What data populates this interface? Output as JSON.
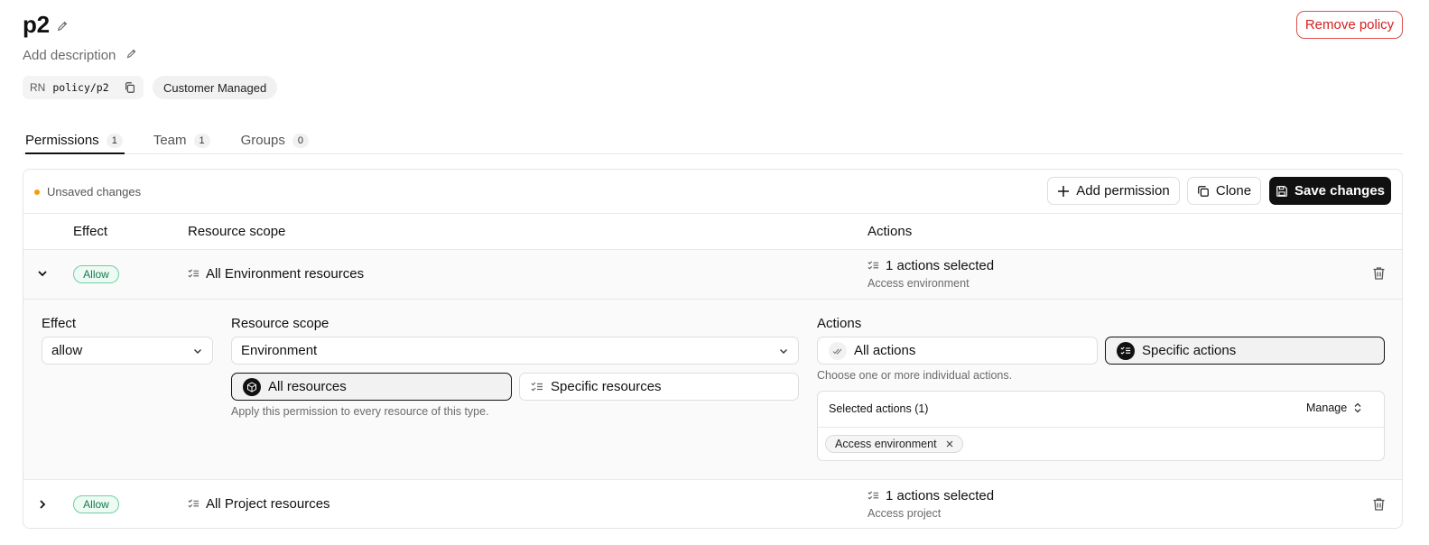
{
  "policy": {
    "title": "p2",
    "description_placeholder": "Add description",
    "rn_label": "RN",
    "rn_value": "policy/p2",
    "type_badge": "Customer Managed",
    "remove_label": "Remove policy"
  },
  "tabs": [
    {
      "label": "Permissions",
      "count": "1",
      "active": true
    },
    {
      "label": "Team",
      "count": "1"
    },
    {
      "label": "Groups",
      "count": "0"
    }
  ],
  "toolbar": {
    "unsaved": "Unsaved changes",
    "add_permission": "Add permission",
    "clone": "Clone",
    "save": "Save changes"
  },
  "table": {
    "headers": {
      "effect": "Effect",
      "scope": "Resource scope",
      "actions": "Actions"
    },
    "rows": [
      {
        "effect": "Allow",
        "scope": "All Environment resources",
        "actions_count": "1 actions selected",
        "actions_sub": "Access environment"
      },
      {
        "effect": "Allow",
        "scope": "All Project resources",
        "actions_count": "1 actions selected",
        "actions_sub": "Access project"
      }
    ]
  },
  "editor": {
    "effect_label": "Effect",
    "effect_value": "allow",
    "scope_label": "Resource scope",
    "scope_value": "Environment",
    "all_resources": "All resources",
    "specific_resources": "Specific resources",
    "scope_hint": "Apply this permission to every resource of this type.",
    "actions_label": "Actions",
    "all_actions": "All actions",
    "specific_actions": "Specific actions",
    "actions_hint": "Choose one or more individual actions.",
    "selected_title": "Selected actions (1)",
    "manage": "Manage",
    "chips": [
      "Access environment"
    ]
  },
  "colors": {
    "accent": "#111111",
    "danger": "#d42020",
    "allow": "#16794f",
    "unsaved_dot": "#f59e0b"
  }
}
